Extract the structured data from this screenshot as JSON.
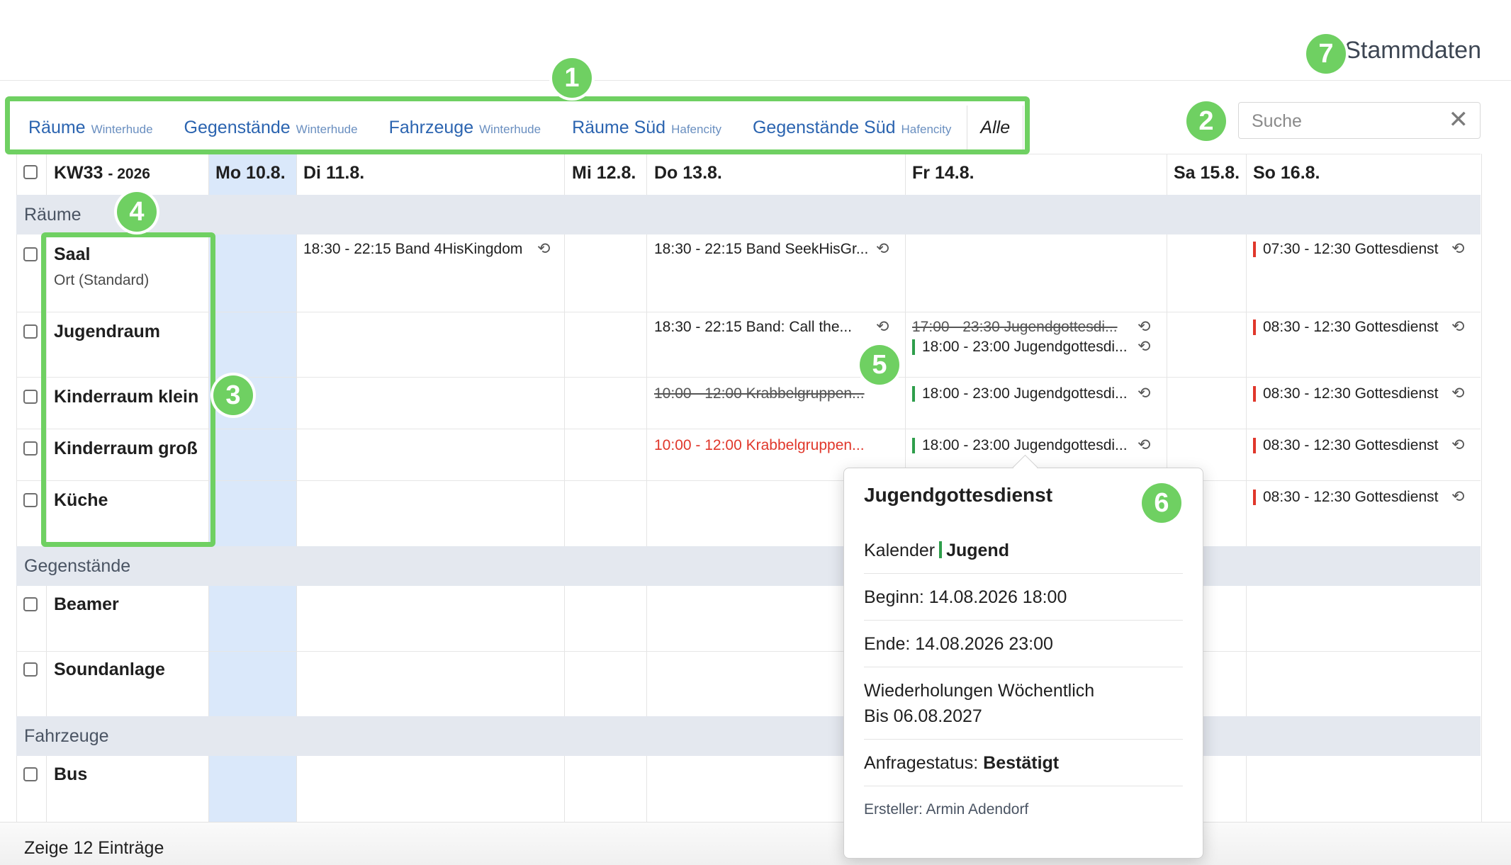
{
  "header": {
    "stammdaten_label": "Stammdaten"
  },
  "annotations": [
    "1",
    "2",
    "3",
    "4",
    "5",
    "6",
    "7"
  ],
  "tabs": [
    {
      "label": "Räume",
      "sub": "Winterhude"
    },
    {
      "label": "Gegenstände",
      "sub": "Winterhude"
    },
    {
      "label": "Fahrzeuge",
      "sub": "Winterhude"
    },
    {
      "label": "Räume Süd",
      "sub": "Hafencity"
    },
    {
      "label": "Gegenstände Süd",
      "sub": "Hafencity"
    },
    {
      "label": "Alle",
      "sub": ""
    }
  ],
  "search": {
    "placeholder": "Suche",
    "clear_icon": "close-icon"
  },
  "week": {
    "label": "KW33",
    "year": "- 2026"
  },
  "days": [
    "Mo 10.8.",
    "Di 11.8.",
    "Mi 12.8.",
    "Do 13.8.",
    "Fr 14.8.",
    "Sa 15.8.",
    "So 16.8."
  ],
  "sections": {
    "raeume": "Räume",
    "gegenstaende": "Gegenstände",
    "fahrzeuge": "Fahrzeuge"
  },
  "resources": {
    "saal": "Saal",
    "saal_sub": "Ort (Standard)",
    "jugendraum": "Jugendraum",
    "kinderraum_klein": "Kinderraum klein",
    "kinderraum_gross": "Kinderraum groß",
    "kueche": "Küche",
    "beamer": "Beamer",
    "soundanlage": "Soundanlage",
    "bus": "Bus"
  },
  "events": {
    "saal_di": "18:30 - 22:15 Band 4HisKingdom",
    "saal_do": "18:30 - 22:15 Band SeekHisGr...",
    "saal_so": "07:30 - 12:30 Gottesdienst",
    "jr_do": "18:30 - 22:15 Band: Call the...",
    "jr_fr_cancel": "17:00 - 23:30 Jugendgottesdi...",
    "jr_fr": "18:00 - 23:00 Jugendgottesdi...",
    "jr_so": "08:30 - 12:30 Gottesdienst",
    "kk_do_cancel": "10:00 - 12:00 Krabbelgruppen...",
    "kk_fr": "18:00 - 23:00 Jugendgottesdi...",
    "kk_so": "08:30 - 12:30 Gottesdienst",
    "kg_do": "10:00 - 12:00 Krabbelgruppen...",
    "kg_fr": "18:00 - 23:00 Jugendgottesdi...",
    "kg_so": "08:30 - 12:30 Gottesdienst",
    "ku_so": "08:30 - 12:30 Gottesdienst"
  },
  "colors": {
    "gottesdienst": "#e0372b",
    "jugend": "#2e9e4b",
    "annotation": "#6fd062",
    "today": "#dae8fa"
  },
  "popup": {
    "title": "Jugendgottesdienst",
    "kalender_label": "Kalender",
    "kalender_value": "Jugend",
    "beginn": "Beginn: 14.08.2026 18:00",
    "ende": "Ende: 14.08.2026 23:00",
    "wiederholung_1": "Wiederholungen Wöchentlich",
    "wiederholung_2": "Bis 06.08.2027",
    "status_label": "Anfragestatus:",
    "status_value": "Bestätigt",
    "ersteller": "Ersteller: Armin Adendorf"
  },
  "footer": {
    "count": "Zeige 12 Einträge"
  }
}
